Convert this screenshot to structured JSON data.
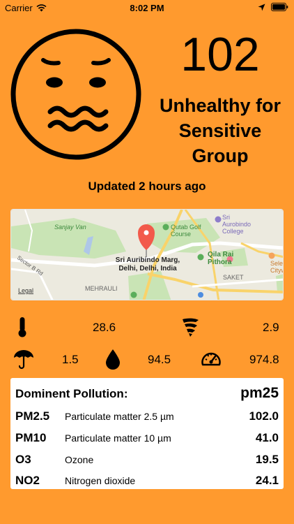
{
  "status_bar": {
    "carrier": "Carrier",
    "time": "8:02 PM",
    "icons": [
      "wifi-icon",
      "location-arrow-icon",
      "battery-icon"
    ]
  },
  "aqi": {
    "value": "102",
    "status_line1": "Unhealthy for",
    "status_line2": "Sensitive",
    "status_line3": "Group",
    "face_icon": "worried-face-icon"
  },
  "updated": "Updated 2 hours ago",
  "map": {
    "pin_label_line1": "Sri Auribindo Marg,",
    "pin_label_line2": "Delhi, Delhi, India",
    "places": [
      "Sanjay Van",
      "Qutab Golf",
      "Course",
      "Sri",
      "Aurobindo",
      "College",
      "Qila Rai",
      "Pithora",
      "Sector B Rd",
      "MEHRAULI",
      "SAKET",
      "Selec",
      "Citywa",
      "Legal"
    ]
  },
  "weather": {
    "temperature": {
      "icon": "thermometer-icon",
      "value": "28.6"
    },
    "wind": {
      "icon": "wind-icon",
      "value": "2.9"
    },
    "rain": {
      "icon": "umbrella-icon",
      "value": "1.5"
    },
    "humidity": {
      "icon": "drop-icon",
      "value": "94.5"
    },
    "pressure": {
      "icon": "gauge-icon",
      "value": "974.8"
    }
  },
  "pollution": {
    "title": "Dominent Pollution:",
    "dominant": "pm25",
    "rows": [
      {
        "code": "PM2.5",
        "name": "Particulate matter 2.5 µm",
        "value": "102.0"
      },
      {
        "code": "PM10",
        "name": "Particulate matter 10 µm",
        "value": "41.0"
      },
      {
        "code": "O3",
        "name": "Ozone",
        "value": "19.5"
      },
      {
        "code": "NO2",
        "name": "Nitrogen dioxide",
        "value": "24.1"
      }
    ]
  },
  "colors": {
    "background": "#FF9A2E",
    "card": "#FFFFFF",
    "pin": "#F25A4B"
  }
}
